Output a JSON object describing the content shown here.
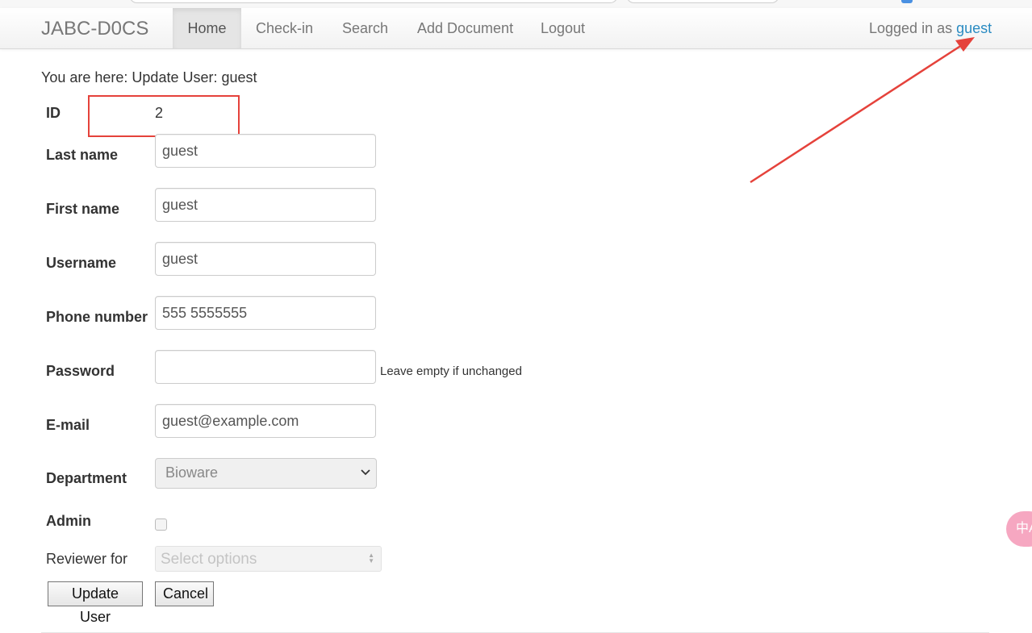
{
  "navbar": {
    "brand": "JABC-D0CS",
    "items": [
      {
        "label": "Home",
        "active": true
      },
      {
        "label": "Check-in"
      },
      {
        "label": "Search"
      },
      {
        "label": "Add Document"
      },
      {
        "label": "Logout"
      }
    ],
    "logged_in_prefix": "Logged in as",
    "username": "guest",
    "link_color": "#2a8bc2"
  },
  "breadcrumb": "You are here: Update User: guest",
  "form": {
    "id_label": "ID",
    "id_value": "2",
    "last_name_label": "Last name",
    "last_name_value": "guest",
    "first_name_label": "First name",
    "first_name_value": "guest",
    "username_label": "Username",
    "username_value": "guest",
    "phone_label": "Phone number",
    "phone_value": "555 5555555",
    "password_label": "Password",
    "password_value": "",
    "password_help": "Leave empty if unchanged",
    "email_label": "E-mail",
    "email_value": "guest@example.com",
    "department_label": "Department",
    "department_selected": "Bioware",
    "admin_label": "Admin",
    "admin_checked": false,
    "reviewer_label": "Reviewer for",
    "reviewer_placeholder": "Select options",
    "update_button": "Update User",
    "cancel_button": "Cancel"
  },
  "annotation": {
    "highlight_color": "#e5423b",
    "side_bubble_text": "中A"
  }
}
